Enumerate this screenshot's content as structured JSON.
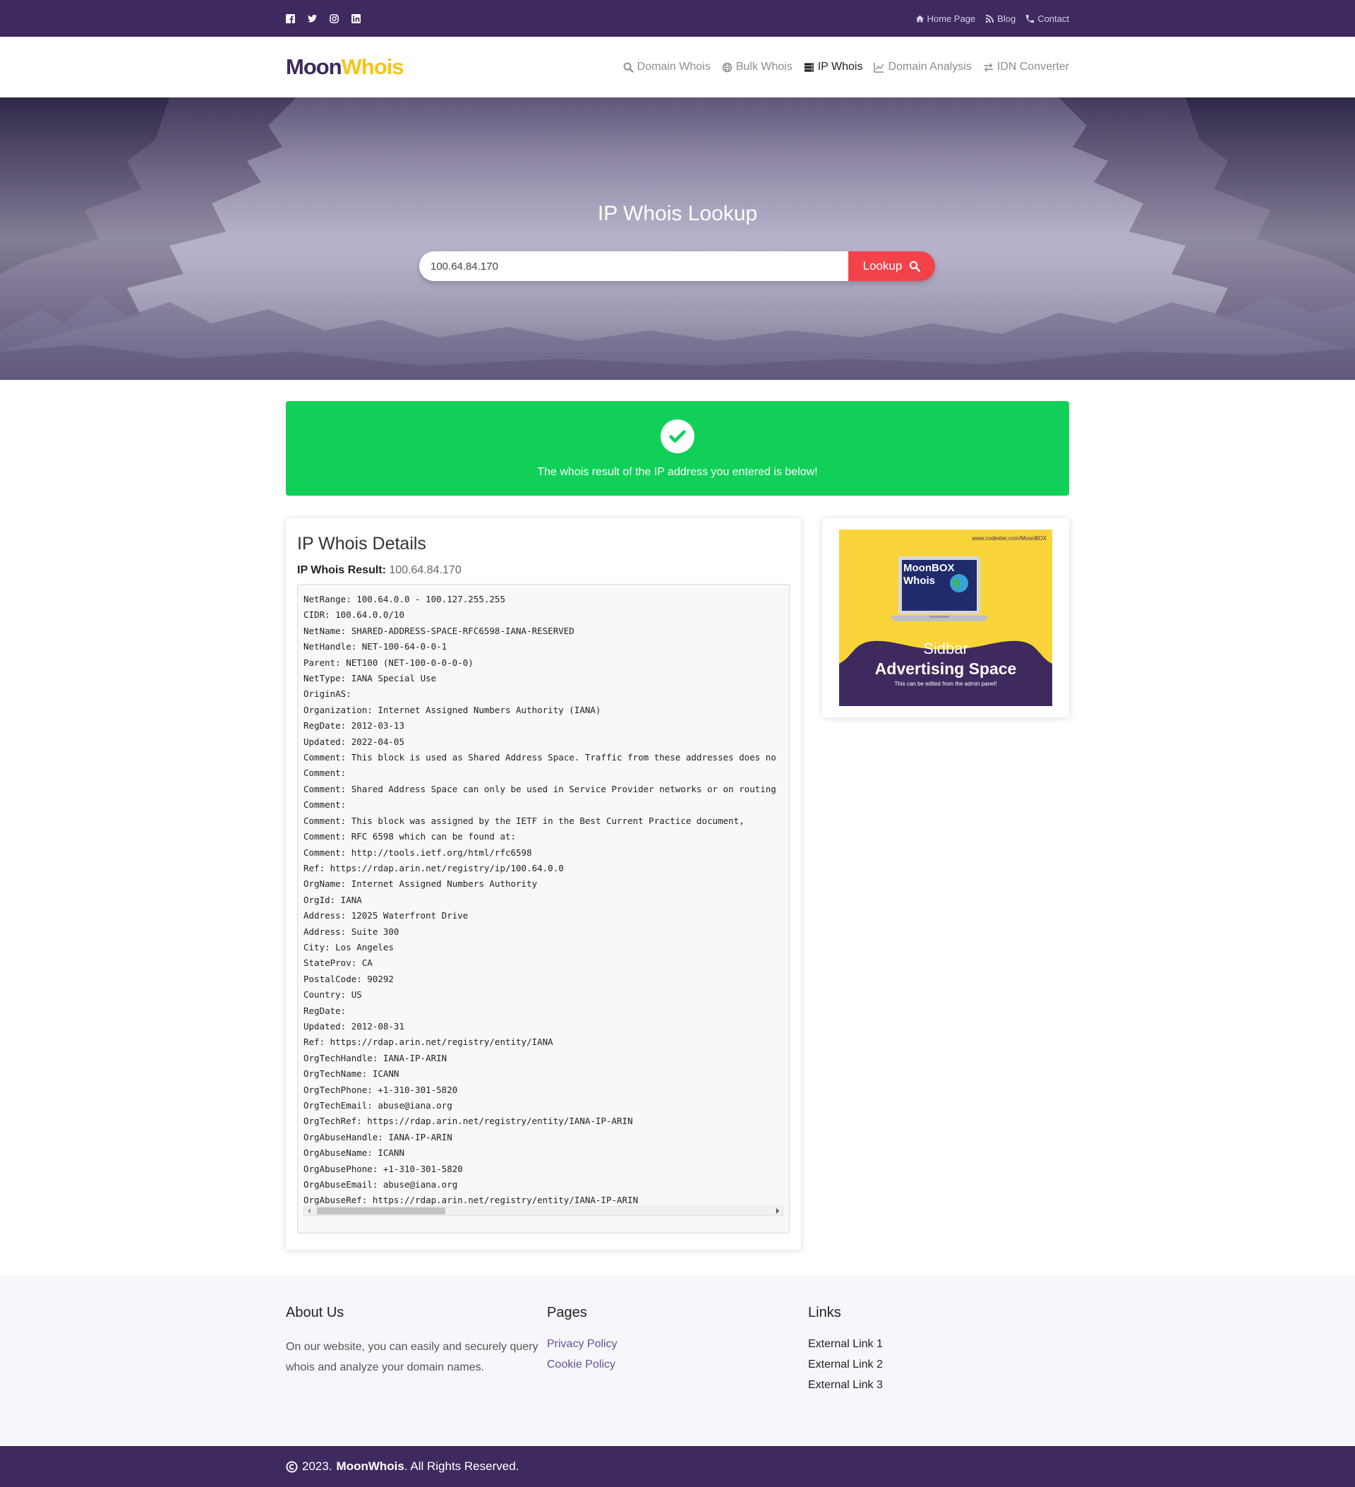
{
  "topbar": {
    "social": [
      "facebook-icon",
      "twitter-icon",
      "instagram-icon",
      "linkedin-icon"
    ],
    "links": [
      {
        "label": "Home Page",
        "icon": "home-icon"
      },
      {
        "label": "Blog",
        "icon": "rss-icon"
      },
      {
        "label": "Contact",
        "icon": "phone-icon"
      }
    ]
  },
  "header": {
    "logo_part1": "Moon",
    "logo_part2": "Whois",
    "nav": [
      {
        "label": "Domain Whois",
        "icon": "search-icon"
      },
      {
        "label": "Bulk Whois",
        "icon": "globe-icon"
      },
      {
        "label": "IP Whois",
        "icon": "server-icon",
        "active": true
      },
      {
        "label": "Domain Analysis",
        "icon": "line-chart-icon"
      },
      {
        "label": "IDN Converter",
        "icon": "exchange-icon"
      }
    ]
  },
  "hero": {
    "title": "IP Whois Lookup",
    "input_value": "100.64.84.170",
    "button_label": "Lookup"
  },
  "alert": {
    "text": "The whois result of the IP address you entered is below!"
  },
  "details": {
    "title": "IP Whois Details",
    "result_label": "IP Whois Result:",
    "result_value": "100.64.84.170",
    "lines": [
      "NetRange: 100.64.0.0 - 100.127.255.255",
      "CIDR: 100.64.0.0/10",
      "NetName: SHARED-ADDRESS-SPACE-RFC6598-IANA-RESERVED",
      "NetHandle: NET-100-64-0-0-1",
      "Parent: NET100 (NET-100-0-0-0-0)",
      "NetType: IANA Special Use",
      "OriginAS:",
      "Organization: Internet Assigned Numbers Authority (IANA)",
      "RegDate: 2012-03-13",
      "Updated: 2022-04-05",
      "Comment: This block is used as Shared Address Space. Traffic from these addresses does no",
      "Comment:",
      "Comment: Shared Address Space can only be used in Service Provider networks or on routing",
      "Comment:",
      "Comment: This block was assigned by the IETF in the Best Current Practice document,",
      "Comment: RFC 6598 which can be found at:",
      "Comment: http://tools.ietf.org/html/rfc6598",
      "Ref: https://rdap.arin.net/registry/ip/100.64.0.0",
      "OrgName: Internet Assigned Numbers Authority",
      "OrgId: IANA",
      "Address: 12025 Waterfront Drive",
      "Address: Suite 300",
      "City: Los Angeles",
      "StateProv: CA",
      "PostalCode: 90292",
      "Country: US",
      "RegDate:",
      "Updated: 2012-08-31",
      "Ref: https://rdap.arin.net/registry/entity/IANA",
      "OrgTechHandle: IANA-IP-ARIN",
      "OrgTechName: ICANN",
      "OrgTechPhone: +1-310-301-5820",
      "OrgTechEmail: abuse@iana.org",
      "OrgTechRef: https://rdap.arin.net/registry/entity/IANA-IP-ARIN",
      "OrgAbuseHandle: IANA-IP-ARIN",
      "OrgAbuseName: ICANN",
      "OrgAbusePhone: +1-310-301-5820",
      "OrgAbuseEmail: abuse@iana.org",
      "OrgAbuseRef: https://rdap.arin.net/registry/entity/IANA-IP-ARIN"
    ]
  },
  "ad": {
    "url": "www.codester.com/MoonBOX",
    "brand_line1": "MoonBOX",
    "brand_line2": "Whois",
    "sub": "Sidbar",
    "title": "Advertising Space",
    "note": "This can be edited from the admin panel!"
  },
  "footer": {
    "about_title": "About Us",
    "about_text": "On our website, you can easily and securely query whois and analyze your domain names.",
    "pages_title": "Pages",
    "pages": [
      "Privacy Policy",
      "Cookie Policy"
    ],
    "links_title": "Links",
    "links": [
      "External Link 1",
      "External Link 2",
      "External Link 3"
    ]
  },
  "copyright": {
    "year": "2023.",
    "brand": "MoonWhois",
    "suffix": ". All Rights Reserved."
  },
  "colors": {
    "brand_purple": "#3e2a5e",
    "brand_yellow": "#f5c518",
    "success_green": "#10d058",
    "button_red": "#f2424a"
  }
}
